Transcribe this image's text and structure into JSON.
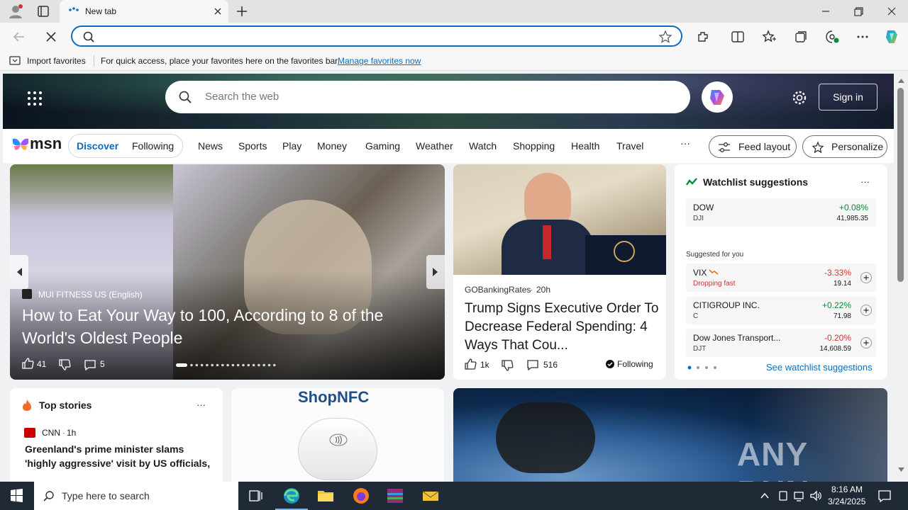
{
  "browser": {
    "tab_title": "New tab",
    "favbar": {
      "import_label": "Import favorites",
      "hint": "For quick access, place your favorites here on the favorites bar.",
      "manage_link": "Manage favorites now"
    }
  },
  "msn": {
    "search_placeholder": "Search the web",
    "sign_in": "Sign in",
    "logo_text": "msn",
    "discover": "Discover",
    "following": "Following",
    "nav_items": [
      "News",
      "Sports",
      "Play",
      "Money",
      "Gaming",
      "Weather",
      "Watch",
      "Shopping",
      "Health",
      "Travel"
    ],
    "more": "···",
    "feed_layout": "Feed layout",
    "personalize": "Personalize"
  },
  "carousel": {
    "source": "MUI FITNESS US (English)",
    "headline": "How to Eat Your Way to 100, According to 8 of the World's Oldest People",
    "likes": "41",
    "comments": "5"
  },
  "trump_card": {
    "source": "GOBankingRates",
    "time": "20h",
    "headline": "Trump Signs Executive Order To Decrease Federal Spending: 4 Ways That Cou...",
    "likes": "1k",
    "comments": "516",
    "following": "Following"
  },
  "watchlist": {
    "title": "Watchlist suggestions",
    "more": "···",
    "main": {
      "name": "DOW",
      "ticker": "DJI",
      "change": "+0.08%",
      "price": "41,985.35"
    },
    "suggested_label": "Suggested for you",
    "suggestions": [
      {
        "name": "VIX",
        "sub": "Dropping fast",
        "change": "-3.33%",
        "price": "19.14"
      },
      {
        "name": "CITIGROUP INC.",
        "sub": "C",
        "change": "+0.22%",
        "price": "71.98"
      },
      {
        "name": "Dow Jones Transport...",
        "sub": "DJT",
        "change": "-0.20%",
        "price": "14,608.59"
      }
    ],
    "see_link": "See watchlist suggestions",
    "colors": {
      "up": "#0a8a3a",
      "down": "#d13438"
    }
  },
  "top_stories": {
    "title": "Top stories",
    "more": "···",
    "source": "CNN",
    "time": "1h",
    "headline": "Greenland's prime minister slams 'highly aggressive' visit by US officials, includi..."
  },
  "ad": {
    "brand": "ShopNFC"
  },
  "watermark": "ANY RUN",
  "taskbar": {
    "search_placeholder": "Type here to search",
    "time": "8:16 AM",
    "date": "3/24/2025"
  },
  "colors": {
    "accent": "#0f6cbd",
    "taskbar": "#1f2a36"
  }
}
